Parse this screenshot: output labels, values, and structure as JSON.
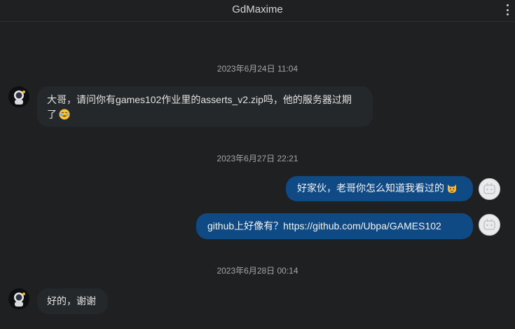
{
  "header": {
    "title": "GdMaxime",
    "menu_icon": "more-vertical-icon"
  },
  "colors": {
    "background": "#1e2022",
    "incoming_bubble": "#25282a",
    "outgoing_bubble": "#0f4a85"
  },
  "timestamps": [
    "2023年6月24日 11:04",
    "2023年6月27日 22:21",
    "2023年6月28日 00:14"
  ],
  "messages": [
    {
      "sender": "contact",
      "text_line1": "大哥，请问你有games102作业里的asserts_v2.zip吗，他的服务器过期",
      "text_line2": "了",
      "emoji": "crying-laughing-emoji"
    },
    {
      "sender": "me",
      "text": "好家伙，老哥你怎么知道我看过的",
      "emoji": "cat-emoji"
    },
    {
      "sender": "me",
      "text": "github上好像有？https://github.com/Ubpa/GAMES102"
    },
    {
      "sender": "contact",
      "text": "好的，谢谢"
    }
  ]
}
